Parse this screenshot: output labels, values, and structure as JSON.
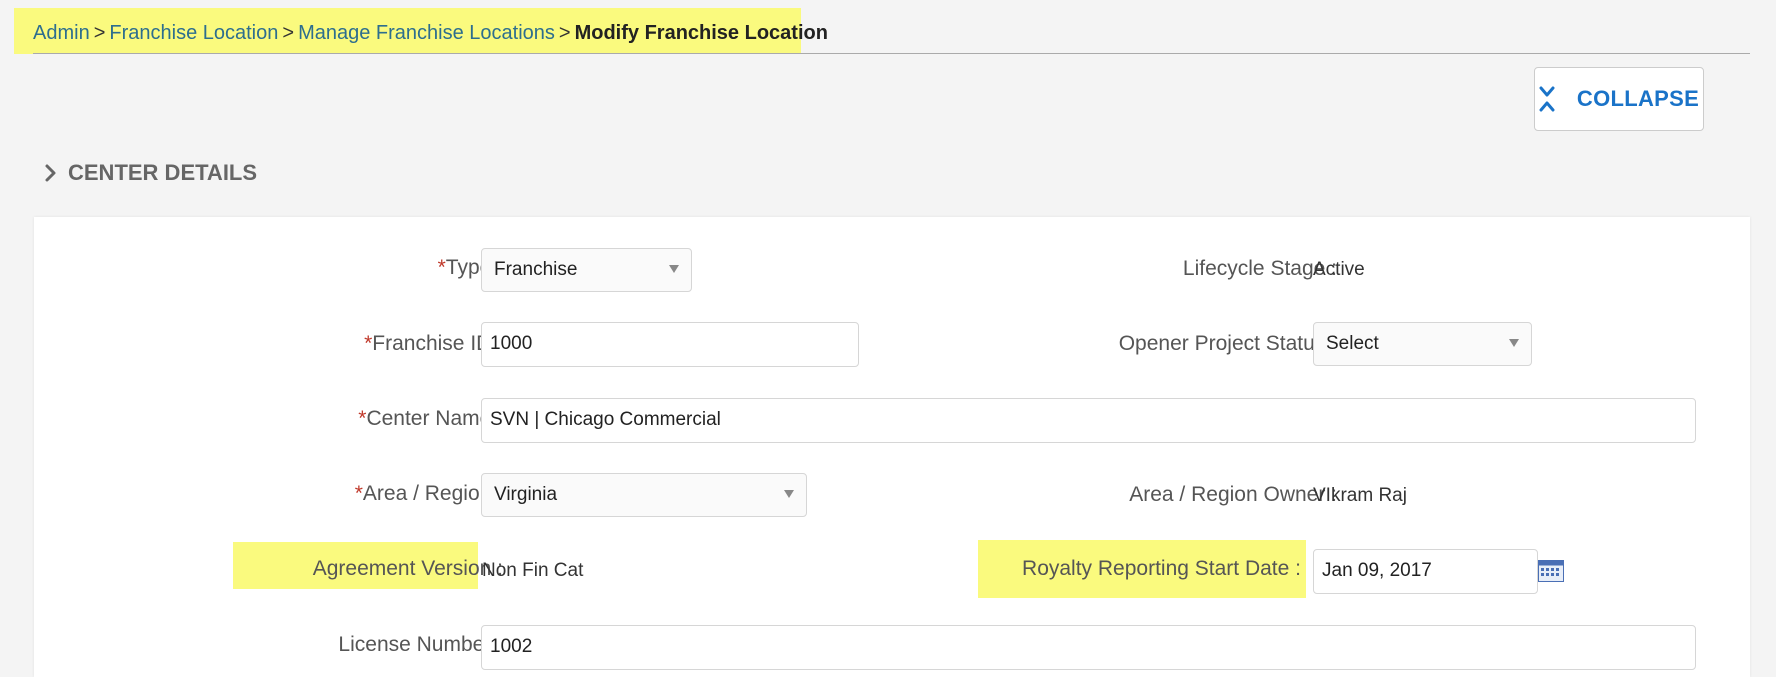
{
  "breadcrumb": {
    "items": [
      "Admin",
      "Franchise Location",
      "Manage Franchise Locations"
    ],
    "current": "Modify Franchise Location",
    "separator": ">"
  },
  "collapse_label": "COLLAPSE",
  "section_title": "CENTER DETAILS",
  "required_marker": "*",
  "form": {
    "type": {
      "label": "Type :",
      "value": "Franchise"
    },
    "lifecycle": {
      "label": "Lifecycle Stage :",
      "value": "Active"
    },
    "franchise_id": {
      "label": "Franchise ID :",
      "value": "1000"
    },
    "opener_status": {
      "label": "Opener Project Status :",
      "value": "Select"
    },
    "center_name": {
      "label": "Center Name :",
      "value": "SVN | Chicago Commercial"
    },
    "area_region": {
      "label": "Area / Region :",
      "value": "Virginia"
    },
    "area_owner": {
      "label": "Area / Region Owner :",
      "value": "VIkram Raj"
    },
    "agreement_version": {
      "label": "Agreement Version :",
      "value": "Non Fin Cat"
    },
    "royalty_start": {
      "label": "Royalty Reporting Start Date :",
      "value": "Jan 09, 2017"
    },
    "license_number": {
      "label": "License Number :",
      "value": "1002"
    }
  },
  "colors": {
    "highlight": "#fafa7e",
    "link": "#2d6e8e",
    "accent": "#1a73c8",
    "required": "#c0392b"
  },
  "icons": {
    "collapse": "collapse-arrows-icon",
    "section": "chevron-right-icon",
    "calendar": "calendar-icon"
  }
}
